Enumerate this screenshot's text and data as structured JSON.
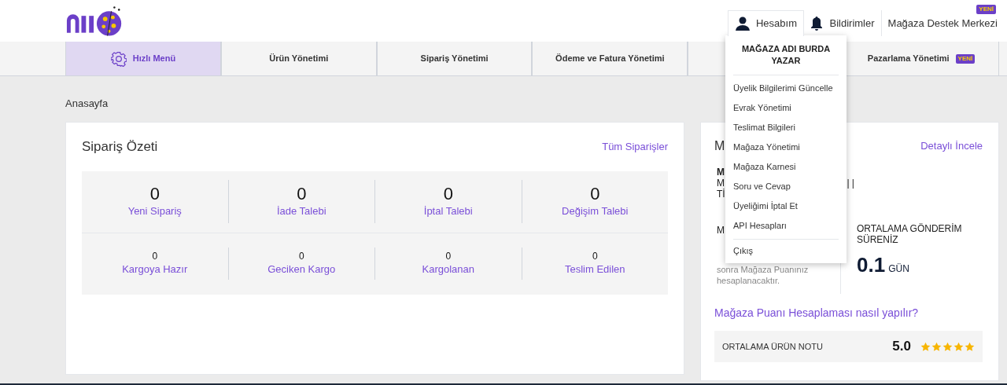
{
  "header": {
    "account": {
      "label": "Hesabım",
      "selected": true
    },
    "notifications": "Bildirimler",
    "support": {
      "label": "Mağaza Destek Merkezi",
      "badge": "YENİ"
    }
  },
  "nav": [
    {
      "label": "Hızlı Menü",
      "selected": true,
      "icon": true
    },
    {
      "label": "Ürün Yönetimi",
      "selected": false
    },
    {
      "label": "Sipariş Yönetimi",
      "selected": false
    },
    {
      "label": "Ödeme ve Fatura Yönetimi",
      "selected": false
    },
    {
      "selected": false
    },
    {
      "label": "Pazarlama Yönetimi",
      "selected": false,
      "badge": "YENİ"
    }
  ],
  "breadcrumb": "Anasayfa",
  "order_summary": {
    "title": "Sipariş Özeti",
    "link": "Tüm Siparişler",
    "primary": [
      {
        "count": "0",
        "label": "Yeni Sipariş"
      },
      {
        "count": "0",
        "label": "İade Talebi"
      },
      {
        "count": "0",
        "label": "İptal Talebi"
      },
      {
        "count": "0",
        "label": "Değişim Talebi"
      }
    ],
    "secondary": [
      {
        "count": "0",
        "label": "Kargoya Hazır"
      },
      {
        "count": "0",
        "label": "Geciken Kargo"
      },
      {
        "count": "0",
        "label": "Kargolanan"
      },
      {
        "count": "0",
        "label": "Teslim Edilen"
      }
    ]
  },
  "store_card": {
    "title": "M",
    "link": "Detaylı İncele",
    "info_lines": [
      "M",
      "M",
      "Tİ"
    ],
    "info_tail": "| |",
    "score_label": "M",
    "score_note": [
      "sonra Mağaza Puanınız",
      "hesaplanacaktır."
    ],
    "shipping_label": "ORTALAMA GÖNDERİM SÜRENİZ",
    "shipping_value": "0.1",
    "shipping_unit": "GÜN",
    "help_link": "Mağaza Puanı Hesaplaması nasıl yapılır?",
    "rating": {
      "label": "ORTALAMA ÜRÜN NOTU",
      "value": "5.0",
      "stars": 5
    }
  },
  "account_menu": {
    "store_name": "MAĞAZA ADI BURDA YAZAR",
    "items": [
      "Üyelik Bilgilerimi Güncelle",
      "Evrak Yönetimi",
      "Teslimat Bilgileri",
      "Mağaza Yönetimi",
      "Mağaza Karnesi",
      "Soru ve Cevap",
      "Üyeliğimi İptal Et",
      "API Hesapları"
    ],
    "logout": "Çıkış"
  }
}
